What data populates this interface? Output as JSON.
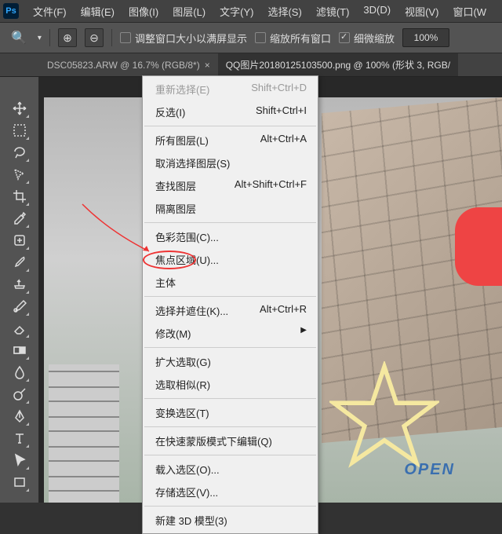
{
  "app": {
    "logo_text": "Ps"
  },
  "menu_bar": {
    "items": [
      "文件(F)",
      "编辑(E)",
      "图像(I)",
      "图层(L)",
      "文字(Y)",
      "选择(S)",
      "滤镜(T)",
      "3D(D)",
      "视图(V)",
      "窗口(W"
    ]
  },
  "options_bar": {
    "fit_screen": "调整窗口大小以满屏显示",
    "zoom_all": "缩放所有窗口",
    "scrubby_zoom": "细微缩放",
    "zoom_value": "100%"
  },
  "tabs": {
    "items": [
      {
        "label": "DSC05823.ARW @ 16.7% (RGB/8*)",
        "active": false
      },
      {
        "label": "QQ图片20180125103500.png @ 100% (形状 3, RGB/",
        "active": true
      }
    ],
    "sub_tab": "RGB/8*) ×"
  },
  "dropdown": {
    "items": [
      {
        "label": "重新选择(E)",
        "shortcut": "Shift+Ctrl+D",
        "disabled": true
      },
      {
        "label": "反选(I)",
        "shortcut": "Shift+Ctrl+I"
      },
      {
        "sep": true
      },
      {
        "label": "所有图层(L)",
        "shortcut": "Alt+Ctrl+A"
      },
      {
        "label": "取消选择图层(S)",
        "shortcut": ""
      },
      {
        "label": "查找图层",
        "shortcut": "Alt+Shift+Ctrl+F"
      },
      {
        "label": "隔离图层",
        "shortcut": ""
      },
      {
        "sep": true
      },
      {
        "label": "色彩范围(C)...",
        "shortcut": ""
      },
      {
        "label": "焦点区域(U)...",
        "shortcut": ""
      },
      {
        "label": "主体",
        "shortcut": ""
      },
      {
        "sep": true
      },
      {
        "label": "选择并遮住(K)...",
        "shortcut": "Alt+Ctrl+R"
      },
      {
        "label": "修改(M)",
        "shortcut": "",
        "submenu": true
      },
      {
        "sep": true
      },
      {
        "label": "扩大选取(G)",
        "shortcut": ""
      },
      {
        "label": "选取相似(R)",
        "shortcut": ""
      },
      {
        "sep": true
      },
      {
        "label": "变换选区(T)",
        "shortcut": ""
      },
      {
        "sep": true
      },
      {
        "label": "在快速蒙版模式下编辑(Q)",
        "shortcut": ""
      },
      {
        "sep": true
      },
      {
        "label": "载入选区(O)...",
        "shortcut": ""
      },
      {
        "label": "存储选区(V)...",
        "shortcut": ""
      },
      {
        "sep": true
      },
      {
        "label": "新建 3D 模型(3)",
        "shortcut": ""
      }
    ]
  },
  "canvas": {
    "sign_text": "OPEN"
  }
}
